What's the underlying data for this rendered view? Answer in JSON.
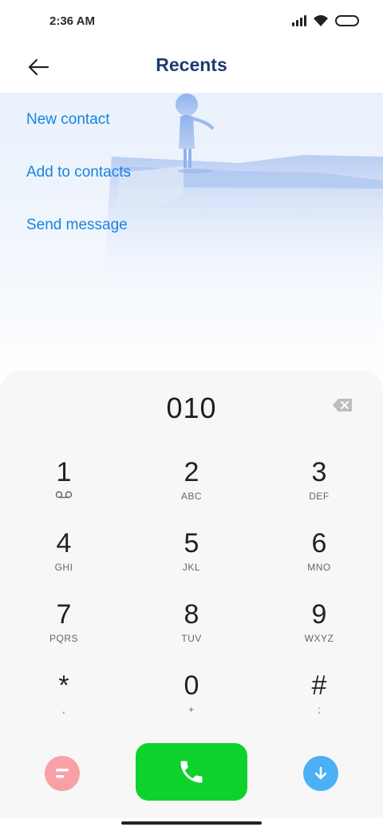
{
  "status_bar": {
    "time": "2:36 AM"
  },
  "header": {
    "title": "Recents"
  },
  "actions": [
    "New contact",
    "Add to contacts",
    "Send message"
  ],
  "dialpad": {
    "number": "010",
    "keys": [
      {
        "digit": "1",
        "letters": ""
      },
      {
        "digit": "2",
        "letters": "ABC"
      },
      {
        "digit": "3",
        "letters": "DEF"
      },
      {
        "digit": "4",
        "letters": "GHI"
      },
      {
        "digit": "5",
        "letters": "JKL"
      },
      {
        "digit": "6",
        "letters": "MNO"
      },
      {
        "digit": "7",
        "letters": "PQRS"
      },
      {
        "digit": "8",
        "letters": "TUV"
      },
      {
        "digit": "9",
        "letters": "WXYZ"
      },
      {
        "digit": "*",
        "letters": ","
      },
      {
        "digit": "0",
        "letters": "+"
      },
      {
        "digit": "#",
        "letters": ";"
      }
    ]
  },
  "colors": {
    "accent": "#1684e3",
    "title": "#1f3a75",
    "call": "#0ed22c",
    "menu": "#f8a0a6",
    "download": "#4bb0f5"
  },
  "icons": {
    "back": "arrow-left-icon",
    "backspace": "backspace-icon",
    "voicemail": "voicemail-icon",
    "menu": "menu-icon",
    "call": "phone-icon",
    "collapse": "arrow-down-icon"
  }
}
